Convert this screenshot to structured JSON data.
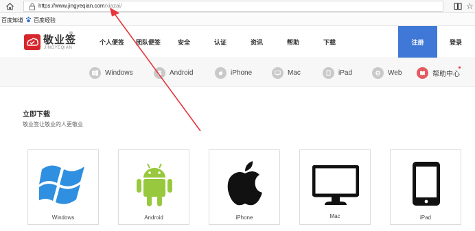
{
  "browser": {
    "url_main": "https://www.jingyeqian.com",
    "url_path": "/xiazai/",
    "favorites": [
      "百度知道",
      "百度经验"
    ]
  },
  "site": {
    "logo_name": "敬业签",
    "logo_reg": "®",
    "logo_sub": "JINGYEQIAN",
    "nav": [
      "个人便签",
      "团队便签",
      "安全",
      "认证",
      "资讯",
      "帮助",
      "下载"
    ],
    "register": "注册",
    "login": "登录"
  },
  "platform_bar": {
    "items": [
      "Windows",
      "Android",
      "iPhone",
      "Mac",
      "iPad",
      "Web",
      "帮助中心"
    ]
  },
  "download": {
    "title": "立即下载",
    "subtitle": "敬业签让敬业的人更敬业",
    "cards": [
      "Windows",
      "Android",
      "iPhone",
      "Mac",
      "iPad"
    ]
  },
  "colors": {
    "accent_blue": "#3f78d6",
    "brand_red": "#d7272d",
    "android_green": "#98c83d",
    "windows_blue": "#2f8fe0",
    "annotation_red": "#e8353a"
  }
}
